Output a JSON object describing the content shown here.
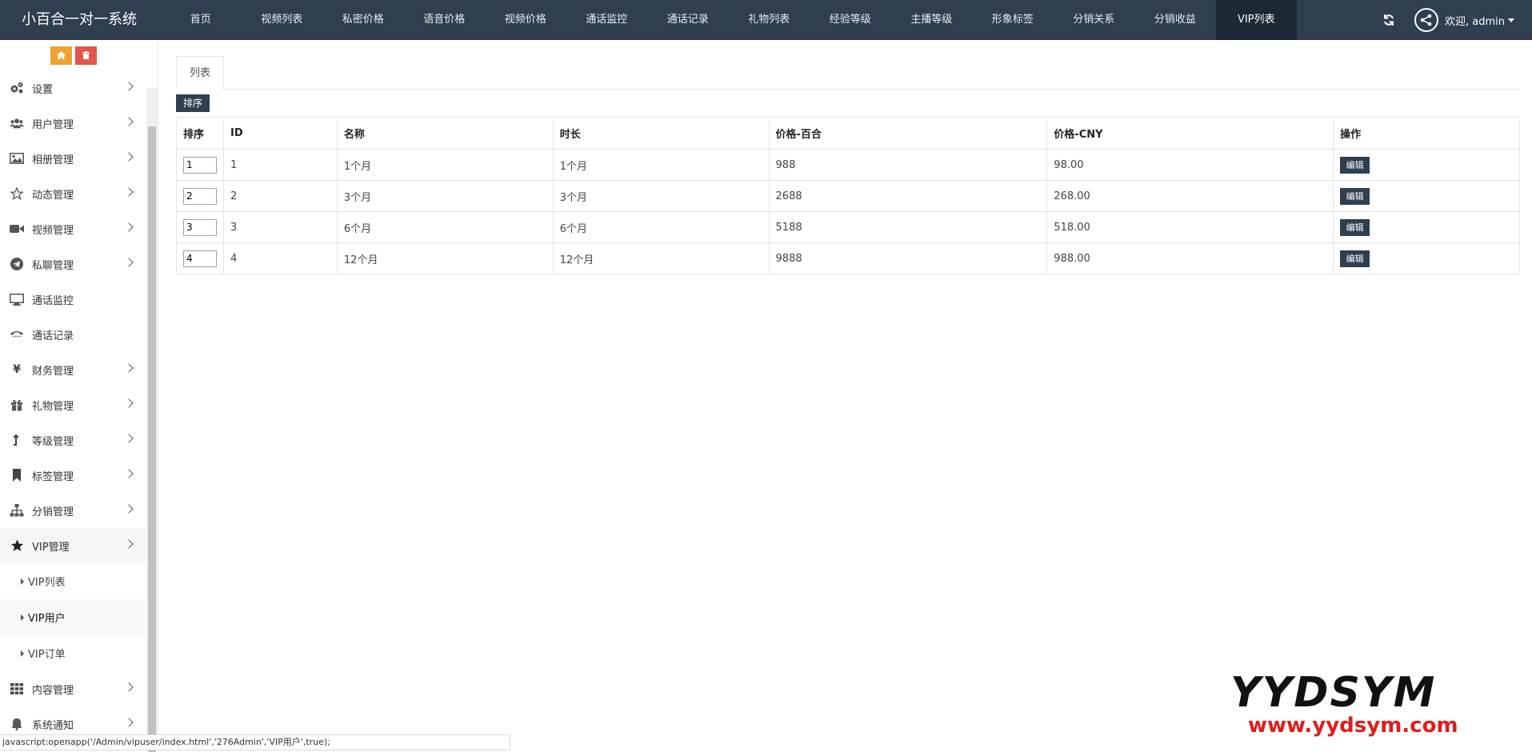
{
  "header": {
    "brand": "小百合一对一系统",
    "nav": [
      "首页",
      "视频列表",
      "私密价格",
      "语音价格",
      "视频价格",
      "通话监控",
      "通话记录",
      "礼物列表",
      "经验等级",
      "主播等级",
      "形象标签",
      "分销关系",
      "分销收益",
      "VIP列表"
    ],
    "active_nav": "VIP列表",
    "welcome": "欢迎, admin"
  },
  "sidebar": {
    "items": [
      {
        "label": "设置",
        "icon": "gears-icon",
        "expandable": true
      },
      {
        "label": "用户管理",
        "icon": "users-icon",
        "expandable": true
      },
      {
        "label": "相册管理",
        "icon": "image-icon",
        "expandable": true
      },
      {
        "label": "动态管理",
        "icon": "star-outline-icon",
        "expandable": true
      },
      {
        "label": "视频管理",
        "icon": "video-camera-icon",
        "expandable": true
      },
      {
        "label": "私聊管理",
        "icon": "telegram-icon",
        "expandable": true
      },
      {
        "label": "通话监控",
        "icon": "desktop-icon",
        "expandable": false
      },
      {
        "label": "通话记录",
        "icon": "phone-icon",
        "expandable": false
      },
      {
        "label": "财务管理",
        "icon": "yen-icon",
        "expandable": true
      },
      {
        "label": "礼物管理",
        "icon": "gift-icon",
        "expandable": true
      },
      {
        "label": "等级管理",
        "icon": "level-up-icon",
        "expandable": true
      },
      {
        "label": "标签管理",
        "icon": "bookmark-icon",
        "expandable": true
      },
      {
        "label": "分销管理",
        "icon": "sitemap-icon",
        "expandable": true
      },
      {
        "label": "VIP管理",
        "icon": "star-icon",
        "expandable": true
      }
    ],
    "vip_sub": [
      "VIP列表",
      "VIP用户",
      "VIP订单"
    ],
    "items_after": [
      {
        "label": "内容管理",
        "icon": "grid-icon",
        "expandable": true
      },
      {
        "label": "系统通知",
        "icon": "bell-icon",
        "expandable": true
      }
    ]
  },
  "content": {
    "tab": "列表",
    "sort_button": "排序",
    "columns": [
      "排序",
      "ID",
      "名称",
      "时长",
      "价格-百合",
      "价格-CNY",
      "操作"
    ],
    "rows": [
      {
        "sort": "1",
        "id": "1",
        "name": "1个月",
        "duration": "1个月",
        "price_lily": "988",
        "price_cny": "98.00",
        "action": "编辑"
      },
      {
        "sort": "2",
        "id": "2",
        "name": "3个月",
        "duration": "3个月",
        "price_lily": "2688",
        "price_cny": "268.00",
        "action": "编辑"
      },
      {
        "sort": "3",
        "id": "3",
        "name": "6个月",
        "duration": "6个月",
        "price_lily": "5188",
        "price_cny": "518.00",
        "action": "编辑"
      },
      {
        "sort": "4",
        "id": "4",
        "name": "12个月",
        "duration": "12个月",
        "price_lily": "9888",
        "price_cny": "988.00",
        "action": "编辑"
      }
    ]
  },
  "statusbar": "javascript:openapp('/Admin/vipuser/index.html','276Admin','VIP用户',true);",
  "watermark": {
    "big": "YYDSYM",
    "url": "www.yydsym.com"
  },
  "colors": {
    "nav_bg": "#2f3f4f",
    "nav_active": "#1c2834",
    "home_btn": "#f0a32f",
    "delete_btn": "#e4564a",
    "watermark_url": "#e31b1b"
  }
}
